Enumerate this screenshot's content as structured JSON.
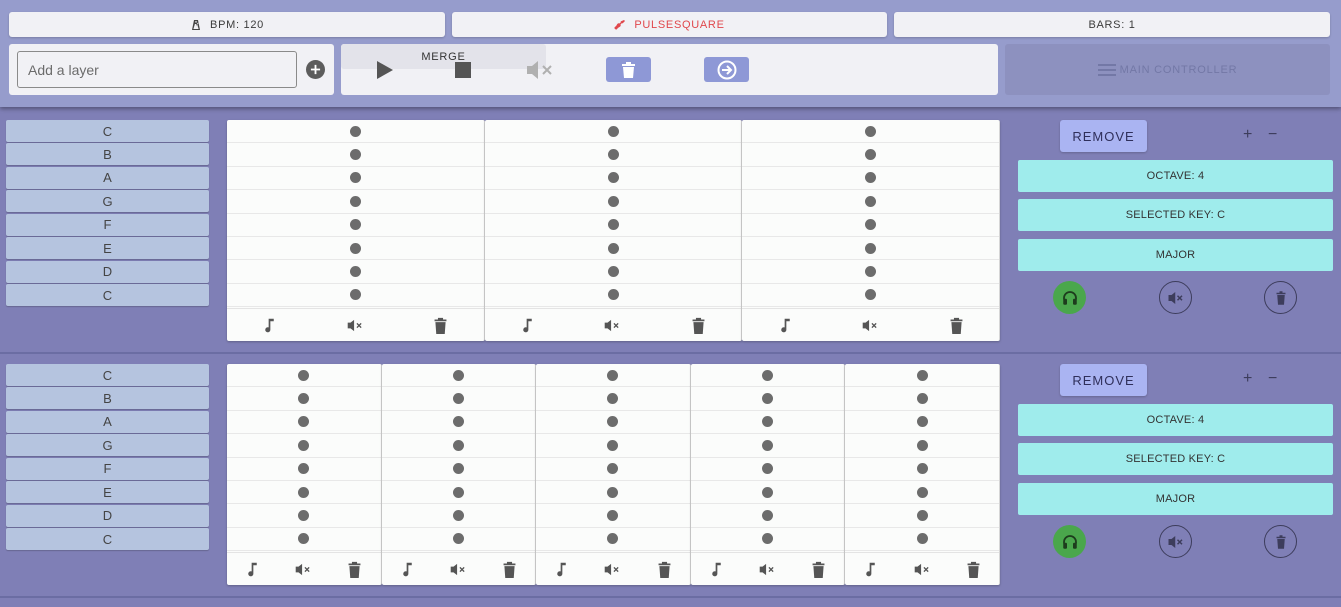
{
  "header": {
    "bpm_label": "BPM: 120",
    "title": "PULSESQUARE",
    "bars_label": "BARS: 1",
    "title_color": "#e0474c"
  },
  "layer_controls": {
    "input_placeholder": "Add a layer",
    "add_icon": "plus-circle-icon"
  },
  "transport": {
    "play_icon": "play-icon",
    "stop_icon": "stop-icon",
    "mute_icon": "volume-off-icon",
    "clear_icon": "trash-icon",
    "export_icon": "arrow-right-circle-icon",
    "merge_label": "MERGE"
  },
  "main_controller": {
    "label": "MAIN CONTROLLER",
    "icon": "menu-icon"
  },
  "layers": [
    {
      "keys": [
        "C",
        "B",
        "A",
        "G",
        "F",
        "E",
        "D",
        "C"
      ],
      "bars": 3,
      "remove_label": "REMOVE",
      "plus_label": "+",
      "minus_label": "−",
      "octave_label": "OCTAVE: 4",
      "key_label": "SELECTED KEY: C",
      "scale_label": "MAJOR",
      "solo_color": "#4aa74c"
    },
    {
      "keys": [
        "C",
        "B",
        "A",
        "G",
        "F",
        "E",
        "D",
        "C"
      ],
      "bars": 5,
      "remove_label": "REMOVE",
      "plus_label": "+",
      "minus_label": "−",
      "octave_label": "OCTAVE: 4",
      "key_label": "SELECTED KEY: C",
      "scale_label": "MAJOR",
      "solo_color": "#4aa74c"
    }
  ],
  "colors": {
    "background": "#7f7fb6",
    "topbar": "#969ccc",
    "accent_button": "#8e98d6",
    "config_button": "#9fecec",
    "remove_button": "#aab4f2",
    "key_button": "#b5c4df"
  }
}
